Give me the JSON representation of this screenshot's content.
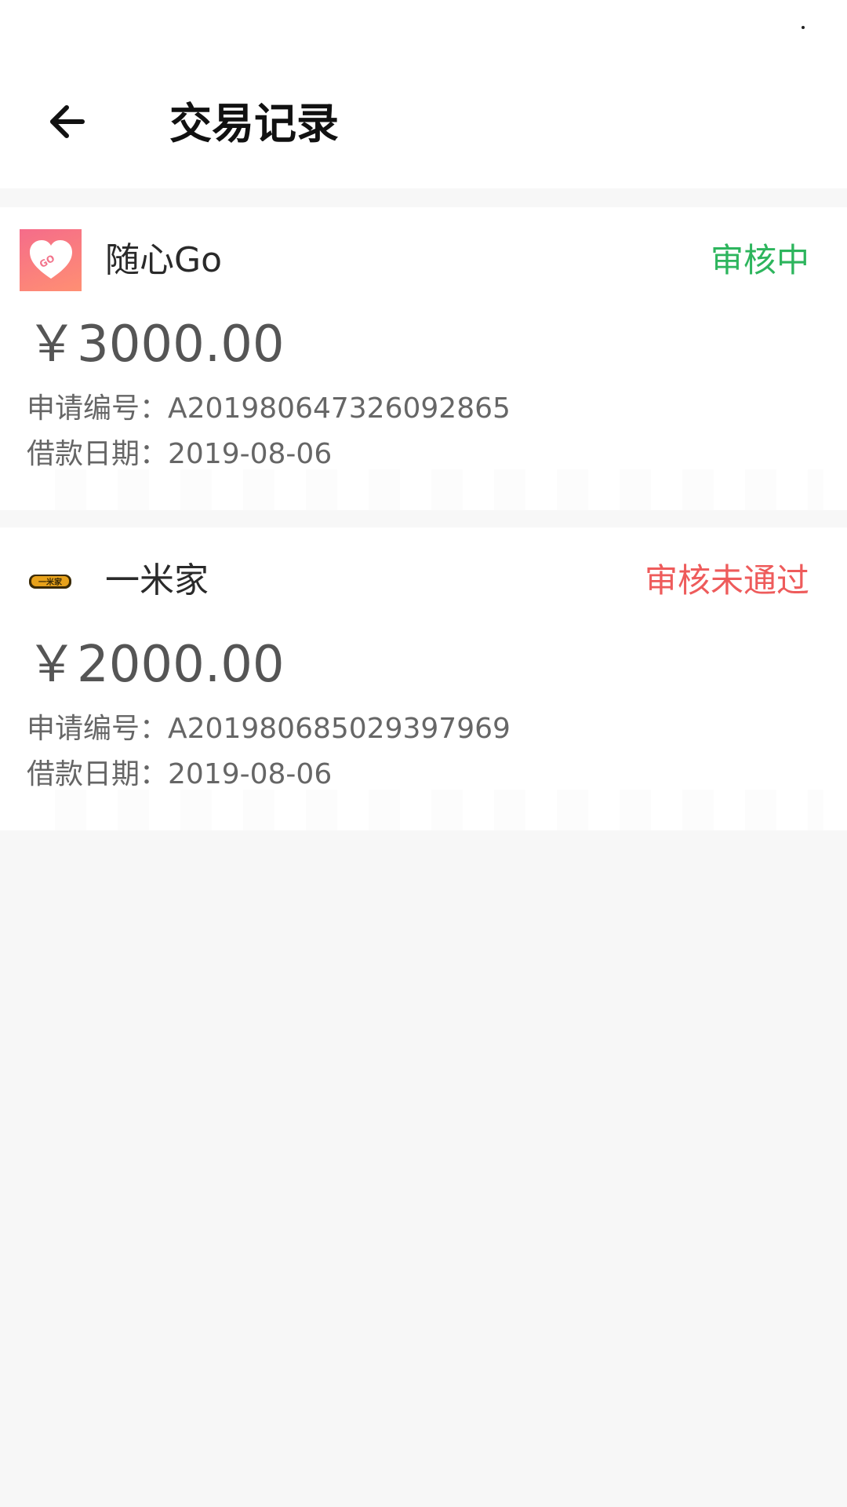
{
  "header": {
    "title": "交易记录",
    "back_icon": "arrow-left-icon"
  },
  "records": [
    {
      "app_name": "随心Go",
      "logo_text": "GO",
      "status": "审核中",
      "status_color": "#2db55d",
      "amount": "￥3000.00",
      "id_label": "申请编号：",
      "id_value": "A201980647326092865",
      "date_label": "借款日期：",
      "date_value": "2019-08-06"
    },
    {
      "app_name": "一米家",
      "logo_text": "一米家",
      "status": "审核未通过",
      "status_color": "#ee5b5b",
      "amount": "￥2000.00",
      "id_label": "申请编号：",
      "id_value": "A201980685029397969",
      "date_label": "借款日期：",
      "date_value": "2019-08-06"
    }
  ]
}
